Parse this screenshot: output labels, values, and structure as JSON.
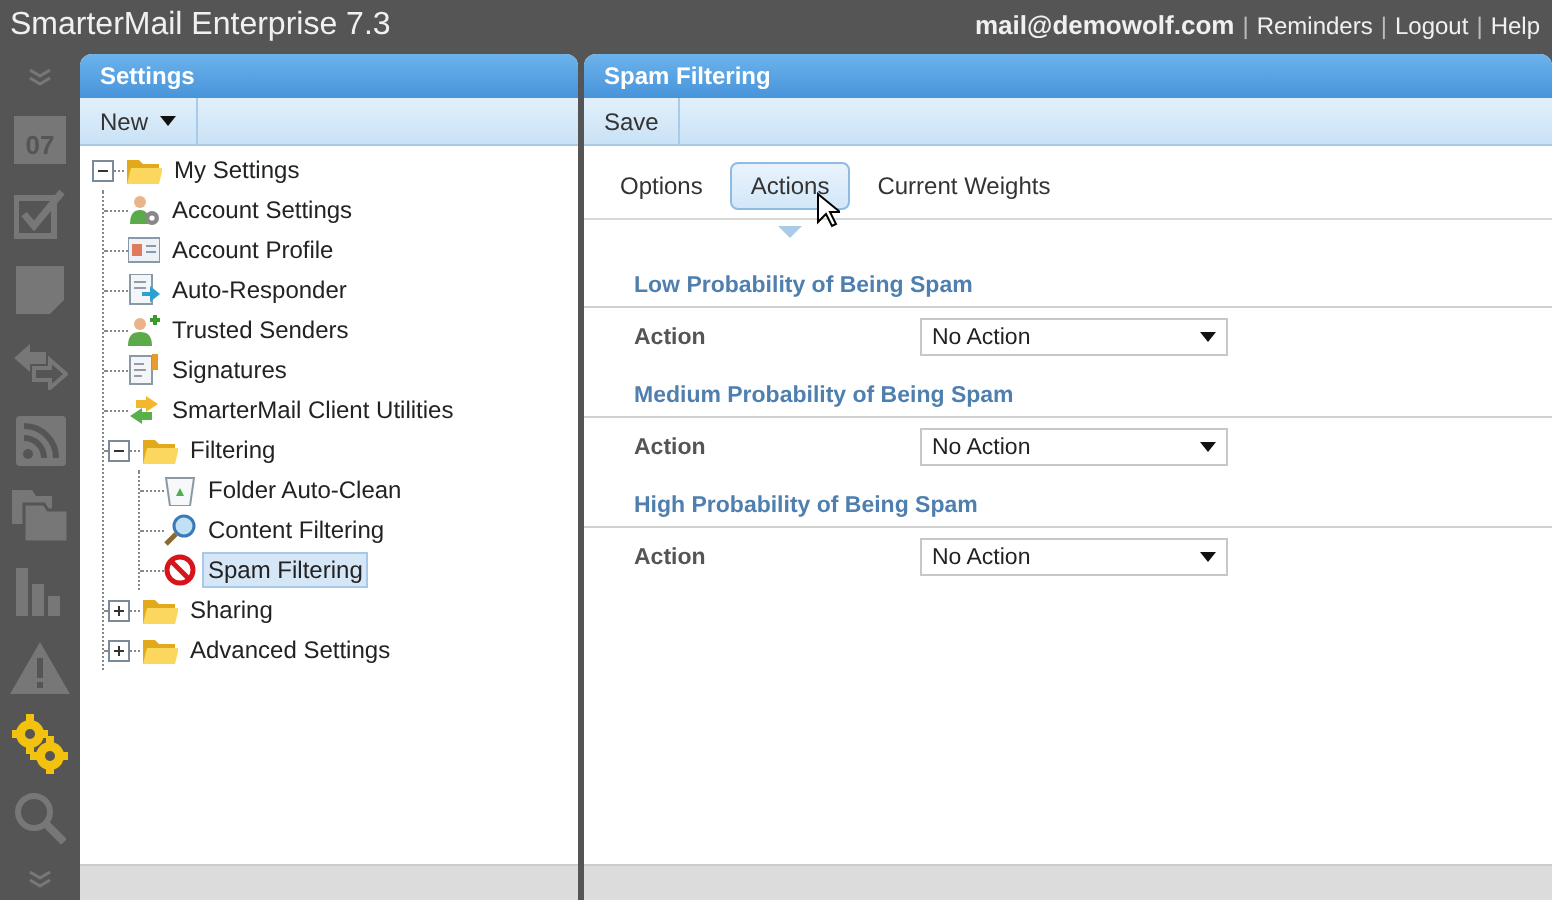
{
  "app_bar": {
    "title": "SmarterMail Enterprise 7.3",
    "account": "mail@demowolf.com",
    "separator": "|",
    "links": [
      "Reminders",
      "Logout",
      "Help"
    ]
  },
  "rail": {
    "items": [
      {
        "kind": "collapse",
        "selected": false
      },
      {
        "kind": "calendar",
        "selected": false,
        "day": "07"
      },
      {
        "kind": "tasks",
        "selected": false
      },
      {
        "kind": "notes",
        "selected": false
      },
      {
        "kind": "sync",
        "selected": false
      },
      {
        "kind": "feeds",
        "selected": false
      },
      {
        "kind": "files",
        "selected": false
      },
      {
        "kind": "reports",
        "selected": false
      },
      {
        "kind": "alerts",
        "selected": false
      },
      {
        "kind": "settings",
        "selected": true
      },
      {
        "kind": "search",
        "selected": false
      },
      {
        "kind": "expand",
        "selected": false
      }
    ]
  },
  "settings_panel": {
    "title": "Settings",
    "toolbar": [
      {
        "label": "New",
        "dropdown": true
      }
    ],
    "tree": [
      {
        "label": "My Settings",
        "kind": "folder",
        "expanded": true,
        "selected": false,
        "children": [
          {
            "label": "Account Settings",
            "kind": "user-gear",
            "selected": false
          },
          {
            "label": "Account Profile",
            "kind": "card",
            "selected": false
          },
          {
            "label": "Auto-Responder",
            "kind": "document-arrow",
            "selected": false
          },
          {
            "label": "Trusted Senders",
            "kind": "user-plus",
            "selected": false
          },
          {
            "label": "Signatures",
            "kind": "document-pen",
            "selected": false
          },
          {
            "label": "SmarterMail Client Utilities",
            "kind": "swap",
            "selected": false
          },
          {
            "label": "Filtering",
            "kind": "folder",
            "expanded": true,
            "selected": false,
            "children": [
              {
                "label": "Folder Auto-Clean",
                "kind": "bin",
                "selected": false
              },
              {
                "label": "Content Filtering",
                "kind": "magnifier",
                "selected": false
              },
              {
                "label": "Spam Filtering",
                "kind": "prohibited",
                "selected": true
              }
            ]
          },
          {
            "label": "Sharing",
            "kind": "folder",
            "expanded": false,
            "selected": false
          },
          {
            "label": "Advanced Settings",
            "kind": "folder",
            "expanded": false,
            "selected": false
          }
        ]
      }
    ]
  },
  "spam_panel": {
    "title": "Spam Filtering",
    "toolbar": [
      {
        "label": "Save",
        "dropdown": false
      }
    ],
    "tabs": [
      {
        "label": "Options",
        "selected": false
      },
      {
        "label": "Actions",
        "selected": true
      },
      {
        "label": "Current Weights",
        "selected": false
      }
    ],
    "sections": [
      {
        "title": "Low Probability of Being Spam",
        "field": {
          "label": "Action",
          "value": "No Action"
        }
      },
      {
        "title": "Medium Probability of Being Spam",
        "field": {
          "label": "Action",
          "value": "No Action"
        }
      },
      {
        "title": "High Probability of Being Spam",
        "field": {
          "label": "Action",
          "value": "No Action"
        }
      }
    ]
  }
}
